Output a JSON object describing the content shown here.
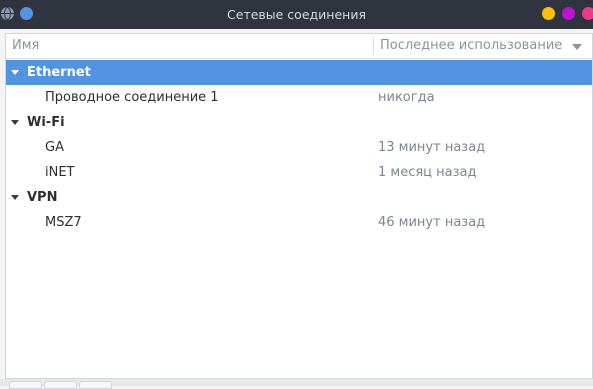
{
  "window": {
    "title": "Сетевые соединения"
  },
  "columns": {
    "name": "Имя",
    "last_used": "Последнее использование"
  },
  "groups": [
    {
      "label": "Ethernet",
      "connections": [
        {
          "name": "Проводное соединение 1",
          "last_used": "никогда"
        }
      ]
    },
    {
      "label": "Wi-Fi",
      "connections": [
        {
          "name": "GA",
          "last_used": "13 минут назад"
        },
        {
          "name": "iNET",
          "last_used": "1 месяц назад"
        }
      ]
    },
    {
      "label": "VPN",
      "connections": [
        {
          "name": "MSZ7",
          "last_used": "46 минут назад"
        }
      ]
    }
  ],
  "selected_group": "Ethernet",
  "colors": {
    "titlebar": "#2f343f",
    "selection": "#5294e2",
    "close": "#e93a8c",
    "maximize": "#b914d1",
    "minimize": "#fdc100"
  }
}
